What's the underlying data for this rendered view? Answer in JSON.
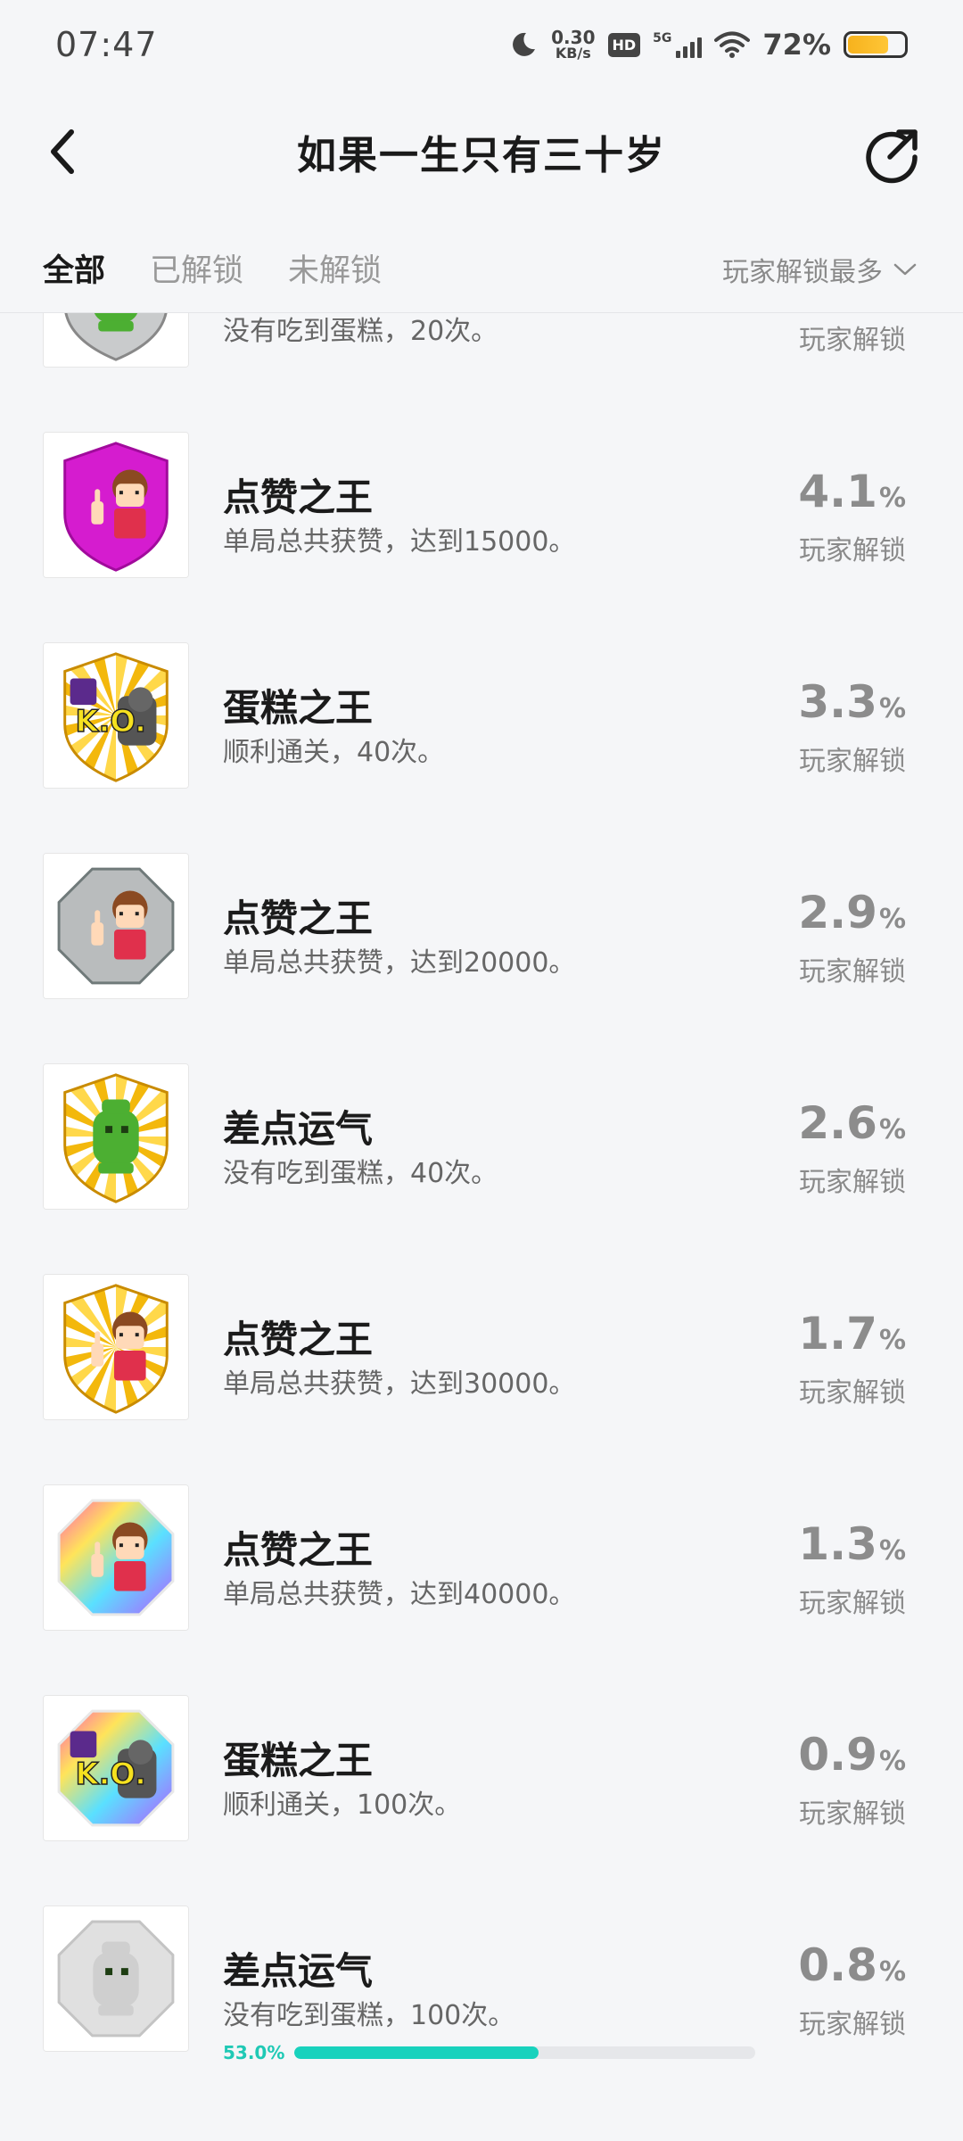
{
  "status_bar": {
    "time": "07:47",
    "net_speed_value": "0.30",
    "net_speed_unit": "KB/s",
    "hd": "HD",
    "network": "5G",
    "battery_pct": "72%",
    "battery_level": 0.72
  },
  "header": {
    "title": "如果一生只有三十岁"
  },
  "tabs": {
    "items": [
      "全部",
      "已解锁",
      "未解锁"
    ],
    "active": "全部",
    "sort_label": "玩家解锁最多"
  },
  "achievements": [
    {
      "title": "",
      "desc": "没有吃到蛋糕，20次。",
      "percent": "",
      "unit": "",
      "label": "玩家解锁",
      "badge": "green-ghost-silver",
      "partial": true
    },
    {
      "title": "点赞之王",
      "desc": "单局总共获赞，达到15000。",
      "percent": "4.1",
      "unit": "%",
      "label": "玩家解锁",
      "badge": "girl-magenta"
    },
    {
      "title": "蛋糕之王",
      "desc": "顺利通关，40次。",
      "percent": "3.3",
      "unit": "%",
      "label": "玩家解锁",
      "badge": "ko-gold"
    },
    {
      "title": "点赞之王",
      "desc": "单局总共获赞，达到20000。",
      "percent": "2.9",
      "unit": "%",
      "label": "玩家解锁",
      "badge": "girl-silver"
    },
    {
      "title": "差点运气",
      "desc": "没有吃到蛋糕，40次。",
      "percent": "2.6",
      "unit": "%",
      "label": "玩家解锁",
      "badge": "ghost-gold"
    },
    {
      "title": "点赞之王",
      "desc": "单局总共获赞，达到30000。",
      "percent": "1.7",
      "unit": "%",
      "label": "玩家解锁",
      "badge": "girl-gold"
    },
    {
      "title": "点赞之王",
      "desc": "单局总共获赞，达到40000。",
      "percent": "1.3",
      "unit": "%",
      "label": "玩家解锁",
      "badge": "girl-rainbow"
    },
    {
      "title": "蛋糕之王",
      "desc": "顺利通关，100次。",
      "percent": "0.9",
      "unit": "%",
      "label": "玩家解锁",
      "badge": "ko-rainbow"
    },
    {
      "title": "差点运气",
      "desc": "没有吃到蛋糕，100次。",
      "percent": "0.8",
      "unit": "%",
      "label": "玩家解锁",
      "badge": "ghost-locked",
      "progress_text": "53.0%",
      "progress": 0.53
    }
  ],
  "colors": {
    "accent": "#18d2bd",
    "magenta": "#d51ccf",
    "gold": "#f3b80c",
    "silver": "#b9bcbd"
  }
}
